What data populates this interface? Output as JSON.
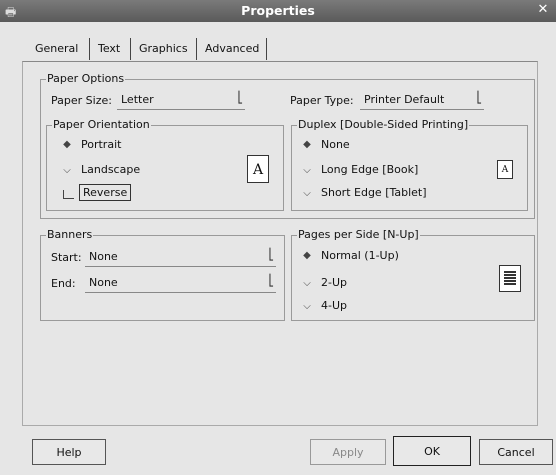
{
  "window": {
    "title": "Properties"
  },
  "tabs": [
    {
      "label": "General"
    },
    {
      "label": "Text"
    },
    {
      "label": "Graphics"
    },
    {
      "label": "Advanced"
    }
  ],
  "paper_options": {
    "legend": "Paper Options",
    "paper_size_label": "Paper Size:",
    "paper_size_value": "Letter",
    "paper_type_label": "Paper Type:",
    "paper_type_value": "Printer Default",
    "orientation": {
      "legend": "Paper Orientation",
      "options": [
        "Portrait",
        "Landscape"
      ],
      "selected": "Portrait",
      "reverse_label": "Reverse",
      "preview_letter": "A"
    },
    "duplex": {
      "legend": "Duplex [Double-Sided Printing]",
      "options": [
        "None",
        "Long Edge [Book]",
        "Short Edge [Tablet]"
      ],
      "selected": "None",
      "preview_letter": "A"
    }
  },
  "banners": {
    "legend": "Banners",
    "start_label": "Start:",
    "start_value": "None",
    "end_label": "End:",
    "end_value": "None"
  },
  "nup": {
    "legend": "Pages per Side [N-Up]",
    "options": [
      "Normal (1-Up)",
      "2-Up",
      "4-Up"
    ],
    "selected": "Normal (1-Up)"
  },
  "buttons": {
    "help": "Help",
    "apply": "Apply",
    "ok": "OK",
    "cancel": "Cancel"
  }
}
